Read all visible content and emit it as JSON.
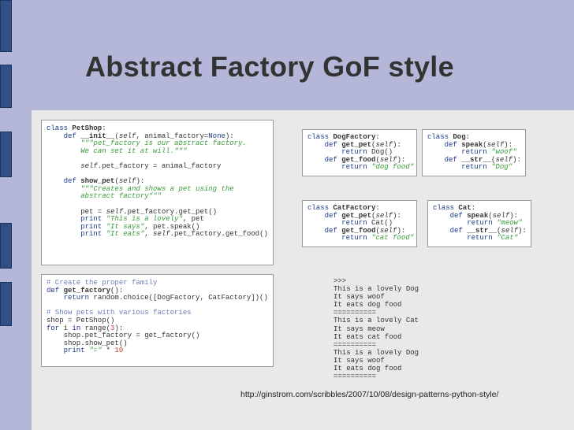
{
  "slide": {
    "title": "Abstract Factory GoF style",
    "source_url": "http://ginstrom.com/scribbles/2007/10/08/design-patterns-python-style/"
  },
  "colors": {
    "title_band": "#b4b7d8",
    "content_background": "#e9e9e9",
    "side_marks": "#2f4f86",
    "keyword": "#1c3a8a",
    "string": "#3a9a3a",
    "comment": "#6a7fb8",
    "number": "#c03a2a",
    "text": "#333333"
  },
  "code": {
    "petshop": [
      [
        [
          "kw",
          "class "
        ],
        [
          "b",
          "PetShop"
        ],
        [
          "",
          ":"
        ]
      ],
      [
        [
          "",
          "    "
        ],
        [
          "kw",
          "def "
        ],
        [
          "b",
          "__init__"
        ],
        [
          "",
          "("
        ],
        [
          "i",
          "self"
        ],
        [
          "",
          ", animal_factory="
        ],
        [
          "kw",
          "None"
        ],
        [
          "",
          "):"
        ]
      ],
      [
        [
          "",
          "        "
        ],
        [
          "str",
          "\"\"\"pet_factory is our abstract factory."
        ]
      ],
      [
        [
          "",
          "        "
        ],
        [
          "str",
          "We can set it at will.\"\"\""
        ]
      ],
      [
        [
          "",
          ""
        ]
      ],
      [
        [
          "",
          "        "
        ],
        [
          "i",
          "self"
        ],
        [
          "",
          ".pet_factory = animal_factory"
        ]
      ],
      [
        [
          "",
          ""
        ]
      ],
      [
        [
          "",
          "    "
        ],
        [
          "kw",
          "def "
        ],
        [
          "b",
          "show_pet"
        ],
        [
          "",
          "("
        ],
        [
          "i",
          "self"
        ],
        [
          "",
          "):"
        ]
      ],
      [
        [
          "",
          "        "
        ],
        [
          "str",
          "\"\"\"Creates and shows a pet using the"
        ]
      ],
      [
        [
          "",
          "        "
        ],
        [
          "str",
          "abstract factory\"\"\""
        ]
      ],
      [
        [
          "",
          ""
        ]
      ],
      [
        [
          "",
          "        pet = "
        ],
        [
          "i",
          "self"
        ],
        [
          "",
          ".pet_factory.get_pet()"
        ]
      ],
      [
        [
          "",
          "        "
        ],
        [
          "kw",
          "print "
        ],
        [
          "str",
          "\"This is a lovely\""
        ],
        [
          "",
          ", pet"
        ]
      ],
      [
        [
          "",
          "        "
        ],
        [
          "kw",
          "print "
        ],
        [
          "str",
          "\"It says\""
        ],
        [
          "",
          ", pet.speak()"
        ]
      ],
      [
        [
          "",
          "        "
        ],
        [
          "kw",
          "print "
        ],
        [
          "str",
          "\"It eats\""
        ],
        [
          "",
          ", "
        ],
        [
          "i",
          "self"
        ],
        [
          "",
          ".pet_factory.get_food()"
        ]
      ]
    ],
    "dog_factory": [
      [
        [
          "kw",
          "class "
        ],
        [
          "b",
          "DogFactory"
        ],
        [
          "",
          ":"
        ]
      ],
      [
        [
          "",
          "    "
        ],
        [
          "kw",
          "def "
        ],
        [
          "b",
          "get_pet"
        ],
        [
          "",
          "("
        ],
        [
          "i",
          "self"
        ],
        [
          "",
          "):"
        ]
      ],
      [
        [
          "",
          "        "
        ],
        [
          "kw",
          "return "
        ],
        [
          "",
          "Dog()"
        ]
      ],
      [
        [
          "",
          "    "
        ],
        [
          "kw",
          "def "
        ],
        [
          "b",
          "get_food"
        ],
        [
          "",
          "("
        ],
        [
          "i",
          "self"
        ],
        [
          "",
          "):"
        ]
      ],
      [
        [
          "",
          "        "
        ],
        [
          "kw",
          "return "
        ],
        [
          "str",
          "\"dog food\""
        ]
      ]
    ],
    "dog": [
      [
        [
          "kw",
          "class "
        ],
        [
          "b",
          "Dog"
        ],
        [
          "",
          ":"
        ]
      ],
      [
        [
          "",
          "    "
        ],
        [
          "kw",
          "def "
        ],
        [
          "b",
          "speak"
        ],
        [
          "",
          "("
        ],
        [
          "i",
          "self"
        ],
        [
          "",
          "):"
        ]
      ],
      [
        [
          "",
          "        "
        ],
        [
          "kw",
          "return "
        ],
        [
          "str",
          "\"woof\""
        ]
      ],
      [
        [
          "",
          "    "
        ],
        [
          "kw",
          "def "
        ],
        [
          "b",
          "__str__"
        ],
        [
          "",
          "("
        ],
        [
          "i",
          "self"
        ],
        [
          "",
          "):"
        ]
      ],
      [
        [
          "",
          "        "
        ],
        [
          "kw",
          "return "
        ],
        [
          "str",
          "\"Dog\""
        ]
      ]
    ],
    "cat_factory": [
      [
        [
          "kw",
          "class "
        ],
        [
          "b",
          "CatFactory"
        ],
        [
          "",
          ":"
        ]
      ],
      [
        [
          "",
          "    "
        ],
        [
          "kw",
          "def "
        ],
        [
          "b",
          "get_pet"
        ],
        [
          "",
          "("
        ],
        [
          "i",
          "self"
        ],
        [
          "",
          "):"
        ]
      ],
      [
        [
          "",
          "        "
        ],
        [
          "kw",
          "return "
        ],
        [
          "",
          "Cat()"
        ]
      ],
      [
        [
          "",
          "    "
        ],
        [
          "kw",
          "def "
        ],
        [
          "b",
          "get_food"
        ],
        [
          "",
          "("
        ],
        [
          "i",
          "self"
        ],
        [
          "",
          "):"
        ]
      ],
      [
        [
          "",
          "        "
        ],
        [
          "kw",
          "return "
        ],
        [
          "str",
          "\"cat food\""
        ]
      ]
    ],
    "cat": [
      [
        [
          "kw",
          "class "
        ],
        [
          "b",
          "Cat"
        ],
        [
          "",
          ":"
        ]
      ],
      [
        [
          "",
          "    "
        ],
        [
          "kw",
          "def "
        ],
        [
          "b",
          "speak"
        ],
        [
          "",
          "("
        ],
        [
          "i",
          "self"
        ],
        [
          "",
          "):"
        ]
      ],
      [
        [
          "",
          "        "
        ],
        [
          "kw",
          "return "
        ],
        [
          "str",
          "\"meow\""
        ]
      ],
      [
        [
          "",
          "    "
        ],
        [
          "kw",
          "def "
        ],
        [
          "b",
          "__str__"
        ],
        [
          "",
          "("
        ],
        [
          "i",
          "self"
        ],
        [
          "",
          "):"
        ]
      ],
      [
        [
          "",
          "        "
        ],
        [
          "kw",
          "return "
        ],
        [
          "str",
          "\"Cat\""
        ]
      ]
    ],
    "main": [
      [
        [
          "com",
          "# Create the proper family"
        ]
      ],
      [
        [
          "kw",
          "def "
        ],
        [
          "b",
          "get_factory"
        ],
        [
          "",
          "():"
        ]
      ],
      [
        [
          "",
          "    "
        ],
        [
          "kw",
          "return "
        ],
        [
          "",
          "random.choice([DogFactory, CatFactory])()"
        ]
      ],
      [
        [
          "",
          ""
        ]
      ],
      [
        [
          "com",
          "# Show pets with various factories"
        ]
      ],
      [
        [
          "",
          "shop = PetShop()"
        ]
      ],
      [
        [
          "kw",
          "for "
        ],
        [
          "",
          "i "
        ],
        [
          "kw",
          "in "
        ],
        [
          "",
          "range("
        ],
        [
          "num",
          "3"
        ],
        [
          "",
          "):"
        ]
      ],
      [
        [
          "",
          "    shop.pet_factory = get_factory()"
        ]
      ],
      [
        [
          "",
          "    shop.show_pet()"
        ]
      ],
      [
        [
          "",
          "    "
        ],
        [
          "kw",
          "print "
        ],
        [
          "str",
          "\"=\""
        ],
        [
          "",
          " * "
        ],
        [
          "num",
          "10"
        ]
      ]
    ]
  },
  "output_lines": [
    ">>>",
    "This is a lovely Dog",
    "It says woof",
    "It eats dog food",
    "==========",
    "This is a lovely Cat",
    "It says meow",
    "It eats cat food",
    "==========",
    "This is a lovely Dog",
    "It says woof",
    "It eats dog food",
    "=========="
  ]
}
